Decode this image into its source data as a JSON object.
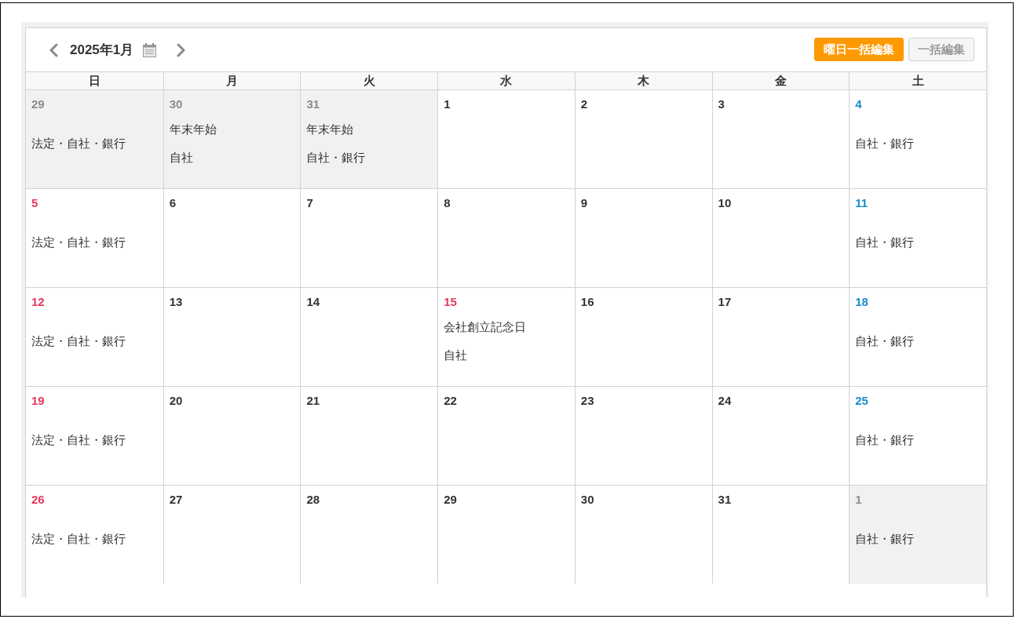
{
  "header": {
    "title": "2025年1月",
    "buttons": [
      {
        "label": "曜日一括編集",
        "kind": "primary",
        "disabled": false
      },
      {
        "label": "一括編集",
        "kind": "default",
        "disabled": true
      }
    ]
  },
  "weekdays": [
    "日",
    "月",
    "火",
    "水",
    "木",
    "金",
    "土"
  ],
  "weeks": [
    {
      "days": [
        {
          "date": "29",
          "kind": "outside",
          "labels": [
            "法定・自社・銀行"
          ]
        },
        {
          "date": "30",
          "kind": "outside",
          "labels": [
            "年末年始",
            "自社"
          ]
        },
        {
          "date": "31",
          "kind": "outside",
          "labels": [
            "年末年始",
            "自社・銀行"
          ]
        },
        {
          "date": "1",
          "kind": "weekday"
        },
        {
          "date": "2",
          "kind": "weekday"
        },
        {
          "date": "3",
          "kind": "weekday"
        },
        {
          "date": "4",
          "kind": "saturday",
          "labels": [
            "自社・銀行"
          ]
        }
      ]
    },
    {
      "days": [
        {
          "date": "5",
          "kind": "sunday",
          "labels": [
            "法定・自社・銀行"
          ]
        },
        {
          "date": "6",
          "kind": "weekday"
        },
        {
          "date": "7",
          "kind": "weekday"
        },
        {
          "date": "8",
          "kind": "weekday"
        },
        {
          "date": "9",
          "kind": "weekday"
        },
        {
          "date": "10",
          "kind": "weekday"
        },
        {
          "date": "11",
          "kind": "saturday",
          "labels": [
            "自社・銀行"
          ]
        }
      ]
    },
    {
      "days": [
        {
          "date": "12",
          "kind": "sunday",
          "labels": [
            "法定・自社・銀行"
          ]
        },
        {
          "date": "13",
          "kind": "weekday"
        },
        {
          "date": "14",
          "kind": "weekday"
        },
        {
          "date": "15",
          "kind": "holiday",
          "labels": [
            "会社創立記念日",
            "自社"
          ]
        },
        {
          "date": "16",
          "kind": "weekday"
        },
        {
          "date": "17",
          "kind": "weekday"
        },
        {
          "date": "18",
          "kind": "saturday",
          "labels": [
            "自社・銀行"
          ]
        }
      ]
    },
    {
      "days": [
        {
          "date": "19",
          "kind": "sunday",
          "labels": [
            "法定・自社・銀行"
          ]
        },
        {
          "date": "20",
          "kind": "weekday"
        },
        {
          "date": "21",
          "kind": "weekday"
        },
        {
          "date": "22",
          "kind": "weekday"
        },
        {
          "date": "23",
          "kind": "weekday"
        },
        {
          "date": "24",
          "kind": "weekday"
        },
        {
          "date": "25",
          "kind": "saturday",
          "labels": [
            "自社・銀行"
          ]
        }
      ]
    },
    {
      "days": [
        {
          "date": "26",
          "kind": "sunday",
          "labels": [
            "法定・自社・銀行"
          ]
        },
        {
          "date": "27",
          "kind": "weekday"
        },
        {
          "date": "28",
          "kind": "weekday"
        },
        {
          "date": "29",
          "kind": "weekday"
        },
        {
          "date": "30",
          "kind": "weekday"
        },
        {
          "date": "31",
          "kind": "weekday"
        },
        {
          "date": "1",
          "kind": "outside",
          "labels": [
            "自社・銀行"
          ]
        }
      ]
    }
  ]
}
